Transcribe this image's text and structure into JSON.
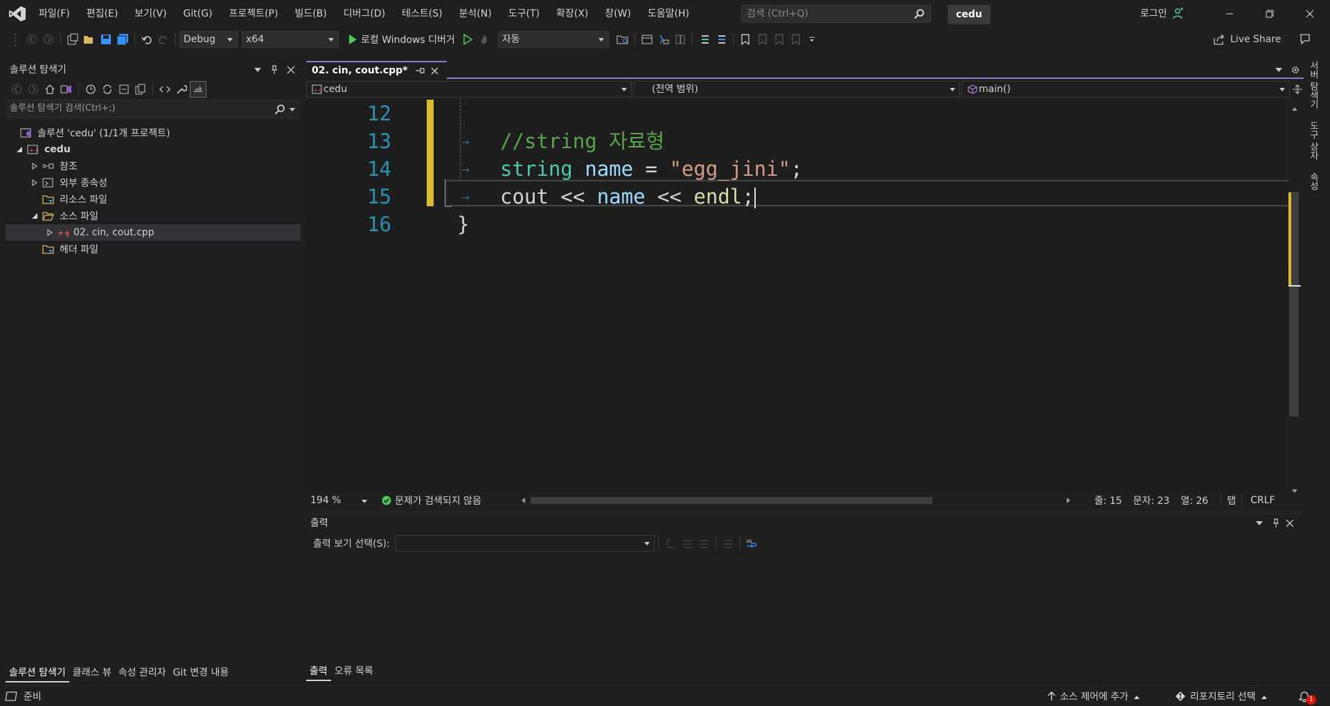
{
  "titlebar": {
    "menu": [
      "파일(F)",
      "편집(E)",
      "보기(V)",
      "Git(G)",
      "프로젝트(P)",
      "빌드(B)",
      "디버그(D)",
      "테스트(S)",
      "분석(N)",
      "도구(T)",
      "확장(X)",
      "창(W)",
      "도움말(H)"
    ],
    "search_placeholder": "검색 (Ctrl+Q)",
    "solution_badge": "cedu",
    "login": "로그인"
  },
  "toolbar": {
    "config": "Debug",
    "platform": "x64",
    "debugger": "로컬 Windows 디버거",
    "mode": "자동",
    "live_share": "Live Share"
  },
  "solution_explorer": {
    "title": "솔루션 탐색기",
    "search_placeholder": "솔루션 탐색기 검색(Ctrl+;)",
    "tree": {
      "solution": "솔루션 'cedu' (1/1개 프로젝트)",
      "project": "cedu",
      "references": "참조",
      "external": "외부 종속성",
      "resources": "리소스 파일",
      "sources": "소스 파일",
      "source_file": "02. cin, cout.cpp",
      "headers": "헤더 파일"
    },
    "bottom_tabs": [
      "솔루션 탐색기",
      "클래스 뷰",
      "속성 관리자",
      "Git 변경 내용"
    ]
  },
  "editor": {
    "tab_title": "02. cin, cout.cpp*",
    "nav_project": "cedu",
    "nav_scope": "(전역 범위)",
    "nav_member": "main()",
    "lines": [
      {
        "num": "12",
        "text": ""
      },
      {
        "num": "13",
        "comment": "//string 자료형"
      },
      {
        "num": "14",
        "type": "string",
        "var": "name",
        "op": " = ",
        "str": "\"egg_jini\"",
        "end": ";"
      },
      {
        "num": "15",
        "fn": "cout",
        "op1": " << ",
        "var": "name",
        "op2": " << ",
        "kw": "endl",
        "end": ";"
      },
      {
        "num": "16",
        "text": "}"
      }
    ],
    "zoom": "194 %",
    "issues": "문제가 검색되지 않음",
    "line_info": "줄: 15",
    "char_info": "문자: 23",
    "col_info": "열: 26",
    "indent": "탭",
    "eol": "CRLF"
  },
  "output": {
    "title": "출력",
    "source_label": "출력 보기 선택(S):",
    "bottom_tabs": [
      "출력",
      "오류 목록"
    ]
  },
  "right_rail": [
    "서버 탐색기",
    "도구 상자",
    "속성"
  ],
  "statusbar": {
    "ready": "준비",
    "source_control": "소스 제어에 추가",
    "repo": "리포지토리 선택",
    "notif_count": "1"
  }
}
